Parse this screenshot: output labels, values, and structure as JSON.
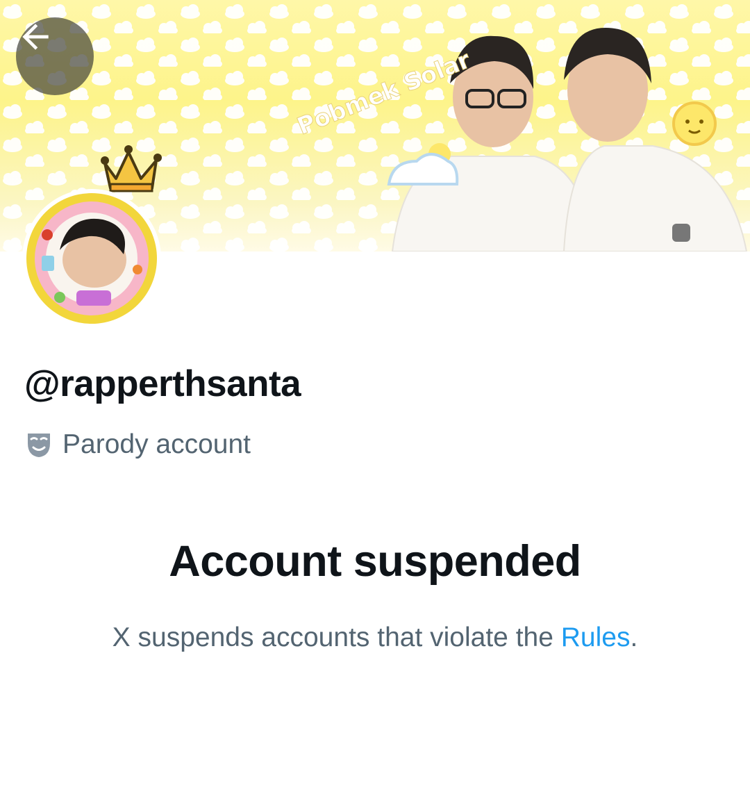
{
  "header": {
    "back_icon": "arrow-left-icon",
    "banner_text": "Pobmek Solar"
  },
  "profile": {
    "handle": "@rapperthsanta",
    "label_icon": "parody-mask-icon",
    "label_text": "Parody account"
  },
  "notice": {
    "title": "Account suspended",
    "message_prefix": "X suspends accounts that violate the ",
    "rules_link": "Rules",
    "message_suffix": "."
  },
  "colors": {
    "text_primary": "#0f1419",
    "text_secondary": "#536471",
    "link": "#1d9bf0",
    "banner_yellow": "#fdf48a"
  }
}
